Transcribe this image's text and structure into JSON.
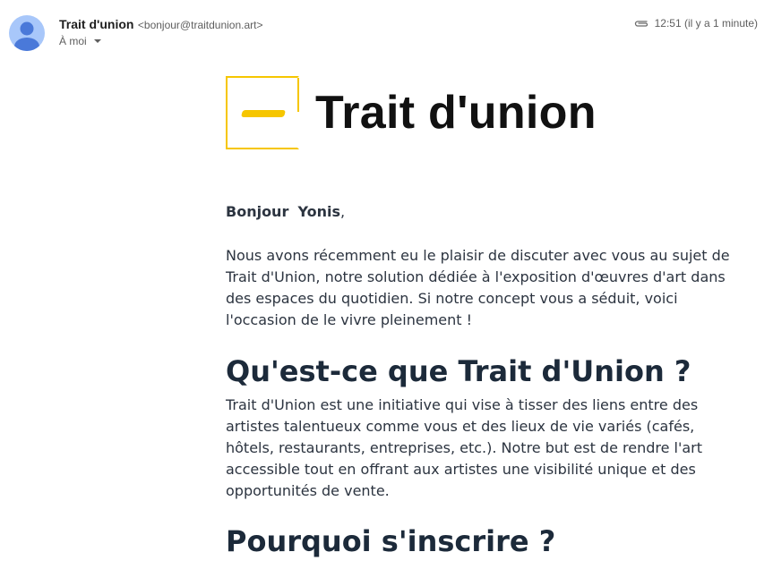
{
  "header": {
    "sender_name": "Trait d'union",
    "sender_email": "<bonjour@traitdunion.art>",
    "recipient": "À moi",
    "time": "12:51 (il y a 1 minute)",
    "attachment_icon": "paperclip-icon",
    "avatar_icon": "person-avatar-icon"
  },
  "email": {
    "logo_text": "Trait d'union",
    "greeting_hello": "Bonjour",
    "greeting_name": "Yonis",
    "greeting_punct": ",",
    "paragraph1": "Nous avons récemment eu le plaisir de discuter avec vous au sujet de Trait d'Union, notre solution dédiée à l'exposition d'œuvres d'art dans des espaces du quotidien. Si notre concept vous a séduit, voici l'occasion de le vivre pleinement !",
    "heading1": "Qu'est-ce que Trait d'Union ?",
    "paragraph2": "Trait d'Union est une initiative qui vise à tisser des liens entre des artistes talentueux comme vous et des lieux de vie variés (cafés, hôtels, restaurants, entreprises, etc.). Notre but est de rendre l'art accessible tout en offrant aux artistes une visibilité unique et des opportunités de vente.",
    "heading2": "Pourquoi s'inscrire ?"
  },
  "colors": {
    "brand_yellow": "#f6c600",
    "heading_color": "#1c2a3a",
    "avatar_bg": "#a8c7fa",
    "avatar_fg": "#4a79d9"
  }
}
